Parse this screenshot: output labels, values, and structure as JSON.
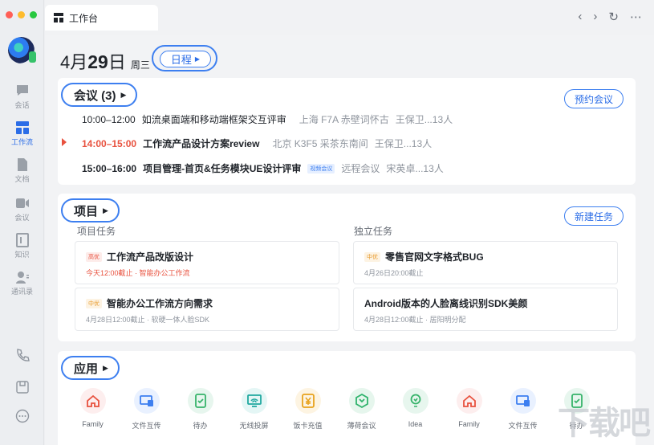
{
  "window": {
    "tab_title": "工作台"
  },
  "sidebar": {
    "items": [
      {
        "label": "会话",
        "icon": "chat-icon"
      },
      {
        "label": "工作流",
        "icon": "workflow-icon",
        "active": true
      },
      {
        "label": "文档",
        "icon": "document-icon"
      },
      {
        "label": "会议",
        "icon": "video-icon"
      },
      {
        "label": "知识",
        "icon": "knowledge-icon"
      },
      {
        "label": "通讯录",
        "icon": "contacts-icon"
      }
    ],
    "bottom_icons": [
      "phone-icon",
      "save-icon",
      "more-icon"
    ]
  },
  "header": {
    "date_prefix": "4月",
    "date_day": "29",
    "date_suffix": "日",
    "weekday": "周三",
    "schedule_label": "日程"
  },
  "meetings": {
    "title": "会议 (3)",
    "book_label": "预约会议",
    "rows": [
      {
        "time": "10:00–12:00",
        "name": "如流桌面端和移动端框架交互评审",
        "place": "上海 F7A 赤壁词怀古",
        "people": "王保卫...13人",
        "state": "normal"
      },
      {
        "time": "14:00–15:00",
        "name": "工作流产品设计方案review",
        "place": "北京 K3F5 采茶东南间",
        "people": "王保卫...13人",
        "state": "current"
      },
      {
        "time": "15:00–16:00",
        "name": "项目管理-首页&任务模块UE设计评审",
        "badge": "视频会议",
        "place": "远程会议",
        "people": "宋英卓...13人",
        "state": "bold"
      }
    ]
  },
  "projects": {
    "title": "项目",
    "new_label": "新建任务",
    "left_label": "项目任务",
    "right_label": "独立任务",
    "tasks": [
      {
        "priority": "高优",
        "title": "工作流产品改版设计",
        "meta": "今天12:00截止 · 智能办公工作流",
        "prio_class": "high",
        "meta_red": true
      },
      {
        "priority": "中优",
        "title": "零售官网文字格式BUG",
        "meta": "4月26日20:00截止",
        "prio_class": "mid"
      },
      {
        "priority": "中优",
        "title": "智能办公工作流方向需求",
        "meta": "4月28日12:00截止 · 软硬一体人脸SDK",
        "prio_class": "mid"
      },
      {
        "priority": "",
        "title": "Android版本的人脸离线识别SDK美颜",
        "meta": "4月28日12:00截止 · 居阳明分配",
        "prio_class": ""
      }
    ]
  },
  "apps_section": {
    "title": "应用",
    "apps": [
      {
        "label": "Family",
        "icon": "home-icon",
        "color": "#e8513e",
        "bg": "#fdeeee"
      },
      {
        "label": "文件互传",
        "icon": "transfer-icon",
        "color": "#3d7ff0",
        "bg": "#e9f1ff"
      },
      {
        "label": "待办",
        "icon": "todo-icon",
        "color": "#36b36a",
        "bg": "#e7f6ee"
      },
      {
        "label": "无线投屏",
        "icon": "cast-icon",
        "color": "#20a8a0",
        "bg": "#e4f6f5"
      },
      {
        "label": "饭卡充值",
        "icon": "yen-icon",
        "color": "#e8a21c",
        "bg": "#fdf4e2"
      },
      {
        "label": "薄荷会议",
        "icon": "mint-icon",
        "color": "#2fb36c",
        "bg": "#e6f6ed"
      },
      {
        "label": "Idea",
        "icon": "idea-icon",
        "color": "#36b36a",
        "bg": "#e7f6ee"
      },
      {
        "label": "Family",
        "icon": "home-icon",
        "color": "#e8513e",
        "bg": "#fdeeee"
      },
      {
        "label": "文件互传",
        "icon": "transfer-icon",
        "color": "#3d7ff0",
        "bg": "#e9f1ff"
      },
      {
        "label": "待办",
        "icon": "todo-icon",
        "color": "#36b36a",
        "bg": "#e7f6ee"
      }
    ]
  },
  "watermark": {
    "text": "下载吧",
    "url": "www.xiazaiba.com"
  }
}
